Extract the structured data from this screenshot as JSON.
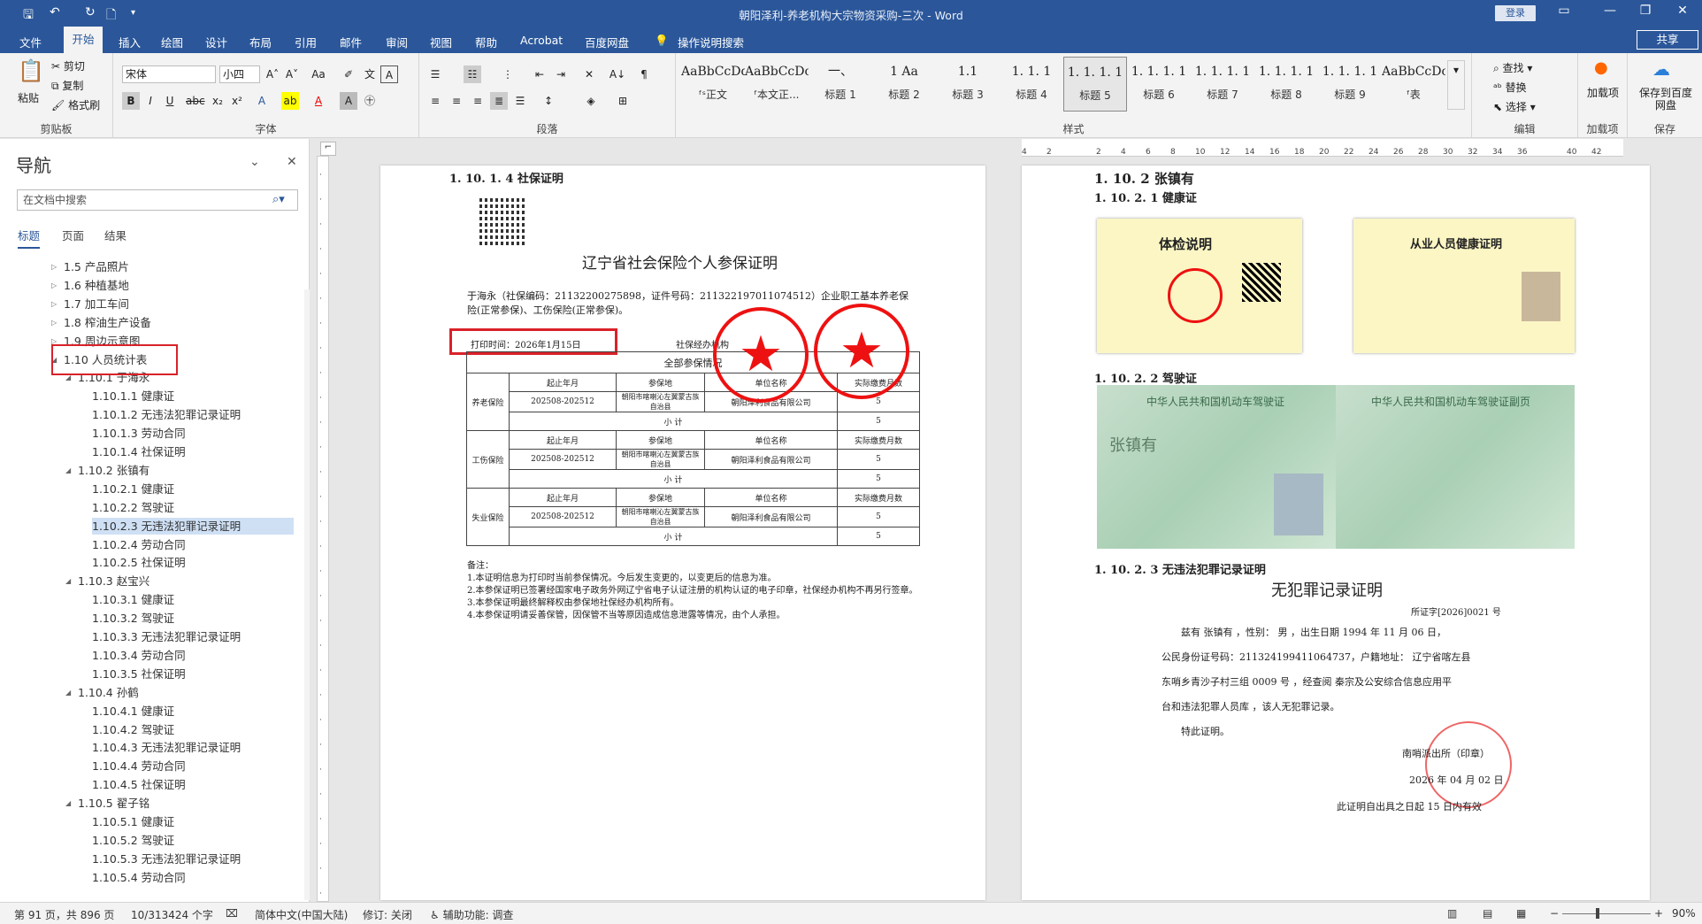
{
  "window": {
    "title": "朝阳泽利-养老机构大宗物资采购-三次 - Word",
    "login": "登录",
    "share": "共享"
  },
  "tabs": [
    "文件",
    "开始",
    "插入",
    "绘图",
    "设计",
    "布局",
    "引用",
    "邮件",
    "审阅",
    "视图",
    "帮助",
    "Acrobat",
    "百度网盘"
  ],
  "tell_me": "操作说明搜索",
  "ribbon": {
    "clipboard": {
      "paste": "粘贴",
      "cut": "剪切",
      "copy": "复制",
      "format_painter": "格式刷",
      "label": "剪贴板"
    },
    "font": {
      "name": "宋体",
      "size": "小四",
      "label": "字体"
    },
    "paragraph": {
      "label": "段落"
    },
    "styles": {
      "label": "样式",
      "items": [
        {
          "preview": "AaBbCcDdI",
          "name": "ᶠˢ正文"
        },
        {
          "preview": "AaBbCcDc",
          "name": "ᶠ本文正..."
        },
        {
          "preview": "一、",
          "name": "标题 1"
        },
        {
          "preview": "1  Aa",
          "name": "标题 2"
        },
        {
          "preview": "1.1",
          "name": "标题 3"
        },
        {
          "preview": "1. 1. 1",
          "name": "标题 4"
        },
        {
          "preview": "1. 1. 1. 1",
          "name": "标题 5"
        },
        {
          "preview": "1. 1. 1. 1",
          "name": "标题 6"
        },
        {
          "preview": "1. 1. 1. 1",
          "name": "标题 7"
        },
        {
          "preview": "1. 1. 1. 1",
          "name": "标题 8"
        },
        {
          "preview": "1. 1. 1. 1",
          "name": "标题 9"
        },
        {
          "preview": "AaBbCcDc",
          "name": "ᶠ表"
        }
      ]
    },
    "editing": {
      "find": "查找",
      "replace": "替换",
      "select": "选择",
      "label": "编辑"
    },
    "addins": {
      "load": "加载项",
      "label": "加载项"
    },
    "save": {
      "baidu": "保存到百度网盘",
      "label": "保存"
    }
  },
  "nav": {
    "title": "导航",
    "search_placeholder": "在文档中搜索",
    "tabs": [
      "标题",
      "页面",
      "结果"
    ],
    "items": [
      {
        "text": "1.5 产品照片",
        "level": 1
      },
      {
        "text": "1.6 种植基地",
        "level": 1
      },
      {
        "text": "1.7 加工车间",
        "level": 1
      },
      {
        "text": "1.8 榨油生产设备",
        "level": 1
      },
      {
        "text": "1.9 周边示意图",
        "level": 1
      },
      {
        "text": "1.10 人员统计表",
        "level": 1
      },
      {
        "text": "1.10.1 于海永",
        "level": 2
      },
      {
        "text": "1.10.1.1 健康证",
        "level": 3
      },
      {
        "text": "1.10.1.2 无违法犯罪记录证明",
        "level": 3
      },
      {
        "text": "1.10.1.3 劳动合同",
        "level": 3
      },
      {
        "text": "1.10.1.4 社保证明",
        "level": 3
      },
      {
        "text": "1.10.2 张镇有",
        "level": 2
      },
      {
        "text": "1.10.2.1 健康证",
        "level": 3
      },
      {
        "text": "1.10.2.2 驾驶证",
        "level": 3
      },
      {
        "text": "1.10.2.3 无违法犯罪记录证明",
        "level": 3
      },
      {
        "text": "1.10.2.4 劳动合同",
        "level": 3
      },
      {
        "text": "1.10.2.5 社保证明",
        "level": 3
      },
      {
        "text": "1.10.3 赵宝兴",
        "level": 2
      },
      {
        "text": "1.10.3.1 健康证",
        "level": 3
      },
      {
        "text": "1.10.3.2 驾驶证",
        "level": 3
      },
      {
        "text": "1.10.3.3 无违法犯罪记录证明",
        "level": 3
      },
      {
        "text": "1.10.3.4 劳动合同",
        "level": 3
      },
      {
        "text": "1.10.3.5 社保证明",
        "level": 3
      },
      {
        "text": "1.10.4 孙鹤",
        "level": 2
      },
      {
        "text": "1.10.4.1 健康证",
        "level": 3
      },
      {
        "text": "1.10.4.2 驾驶证",
        "level": 3
      },
      {
        "text": "1.10.4.3 无违法犯罪记录证明",
        "level": 3
      },
      {
        "text": "1.10.4.4 劳动合同",
        "level": 3
      },
      {
        "text": "1.10.4.5 社保证明",
        "level": 3
      },
      {
        "text": "1.10.5 翟子铭",
        "level": 2
      },
      {
        "text": "1.10.5.1 健康证",
        "level": 3
      },
      {
        "text": "1.10.5.2 驾驶证",
        "level": 3
      },
      {
        "text": "1.10.5.3 无违法犯罪记录证明",
        "level": 3
      },
      {
        "text": "1.10.5.4 劳动合同",
        "level": 3
      }
    ]
  },
  "page_left": {
    "heading": "1. 10. 1. 4 社保证明",
    "cert_title": "辽宁省社会保险个人参保证明",
    "intro": "于海永（社保编码：21132200275898，证件号码：211322197011074512）企业职工基本养老保险(正常参保)、工伤保险(正常参保)。",
    "print_time": "打印时间：2026年1月15日",
    "agency": "社保经办机构",
    "table_title": "全部参保情况",
    "headers": [
      "起止年月",
      "参保地",
      "单位名称",
      "实际缴费月数"
    ],
    "rows": [
      {
        "type": "养老保险",
        "period": "202508-202512",
        "place": "朝阳市喀喇沁左翼蒙古族自治县",
        "unit": "朝阳泽利食品有限公司",
        "months": "5"
      },
      {
        "type": "工伤保险",
        "period": "202508-202512",
        "place": "朝阳市喀喇沁左翼蒙古族自治县",
        "unit": "朝阳泽利食品有限公司",
        "months": "5"
      },
      {
        "type": "失业保险",
        "period": "202508-202512",
        "place": "朝阳市喀喇沁左翼蒙古族自治县",
        "unit": "朝阳泽利食品有限公司",
        "months": "5"
      }
    ],
    "subtotal": "小    计",
    "notes": [
      "备注：",
      "1.本证明信息为打印时当前参保情况。今后发生变更的，以变更后的信息为准。",
      "2.本参保证明已签署经国家电子政务外网辽宁省电子认证注册的机构认证的电子印章，社保经办机构不再另行签章。",
      "3.本参保证明最终解释权由参保地社保经办机构所有。",
      "4.本参保证明请妥善保管，因保管不当等原因造成信息泄露等情况，由个人承担。"
    ]
  },
  "page_right": {
    "h1": "1. 10. 2 张镇有",
    "h2": "1. 10. 2. 1 健康证",
    "card1_title": "体检说明",
    "card2_title": "从业人员健康证明",
    "h3": "1. 10. 2. 2 驾驶证",
    "license_left": "中华人民共和国机动车驾驶证",
    "license_right": "中华人民共和国机动车驾驶证副页",
    "license_name": "张镇有",
    "h4": "1. 10. 2. 3 无违法犯罪记录证明",
    "crime_title": "无犯罪记录证明",
    "crime_no": "所证字[2026]0021 号",
    "crime_lines": [
      "兹有  张镇有  ，性别：  男  ，出生日期 1994 年 11 月 06 日，",
      "公民身份证号码：211324199411064737，户籍地址：  辽宁省喀左县",
      "东哨乡青沙子村三组 0009 号  ，经查阅  秦宗及公安综合信息应用平",
      "台和违法犯罪人员库  ，该人无犯罪记录。",
      "特此证明。"
    ],
    "crime_issuer": "南哨派出所（印章）",
    "crime_date": "2026 年 04 月 02 日",
    "crime_valid": "此证明自出具之日起 15 日内有效"
  },
  "status": {
    "page": "第 91 页，共 896 页",
    "words": "10/313424 个字",
    "lang": "简体中文(中国大陆)",
    "track": "修订: 关闭",
    "access": "辅助功能: 调查",
    "zoom": "90%"
  }
}
